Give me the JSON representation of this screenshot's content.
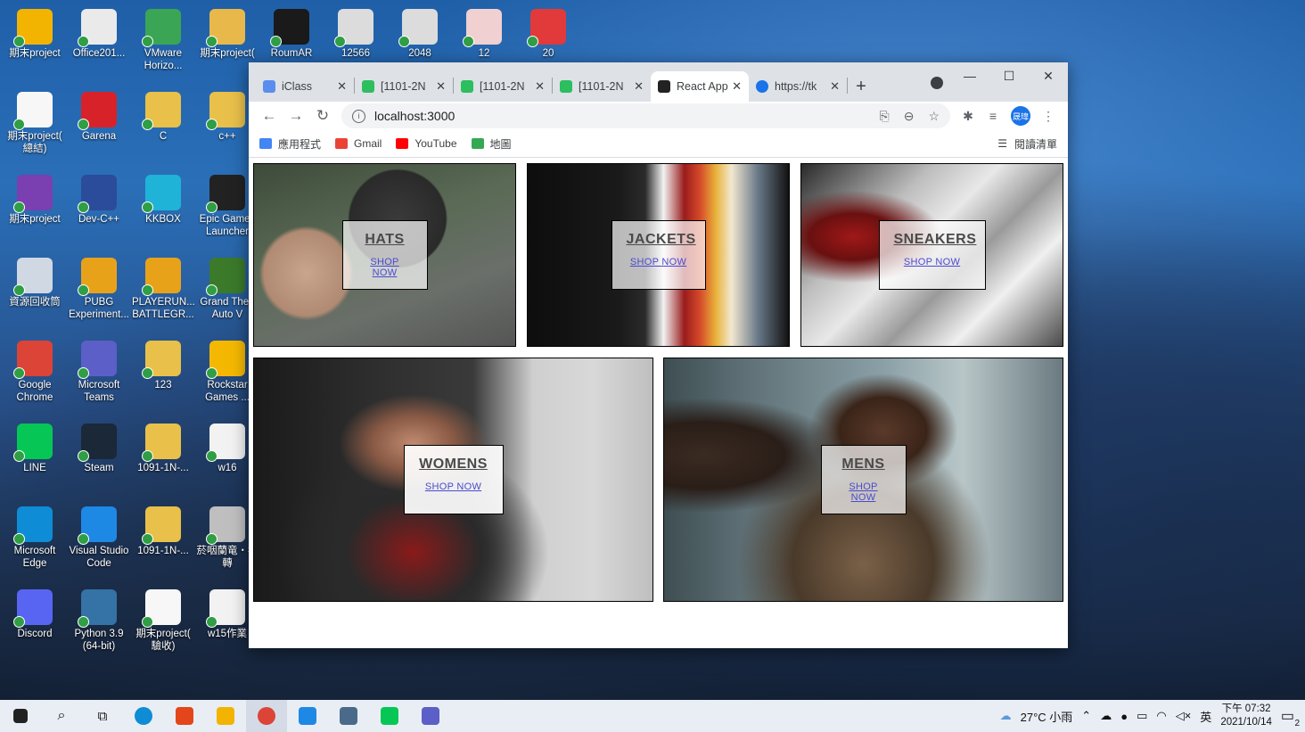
{
  "desktop": {
    "icons": [
      {
        "label": "期末project",
        "color": "#f2b400"
      },
      {
        "label": "Office201...",
        "color": "#eaeaea"
      },
      {
        "label": "VMware Horizo...",
        "color": "#3aa655"
      },
      {
        "label": "期末project(",
        "color": "#e8b94a"
      },
      {
        "label": "RoumAR",
        "color": "#1a1a1a"
      },
      {
        "label": "12566",
        "color": "#dcdcdc"
      },
      {
        "label": "2048",
        "color": "#dcdcdc"
      },
      {
        "label": "12",
        "color": "#f0d0d0"
      },
      {
        "label": "20",
        "color": "#e23a3a"
      },
      {
        "label": "期末project( 總結)",
        "color": "#f7f7f7"
      },
      {
        "label": "Garena",
        "color": "#d8222a"
      },
      {
        "label": "C",
        "color": "#e8c04a"
      },
      {
        "label": "c++",
        "color": "#e8c04a"
      },
      {
        "label": "期末project",
        "color": "#7a3fb0"
      },
      {
        "label": "Dev-C++",
        "color": "#2b4c9a"
      },
      {
        "label": "KKBOX",
        "color": "#1fb3d8"
      },
      {
        "label": "Epic Games Launcher",
        "color": "#222222"
      },
      {
        "label": "資源回收筒",
        "color": "#cfd8e3"
      },
      {
        "label": "PUBG Experiment...",
        "color": "#e8a21a"
      },
      {
        "label": "PLAYERUN... BATTLEGR...",
        "color": "#e8a21a"
      },
      {
        "label": "Grand Theft Auto V",
        "color": "#3b7a2a"
      },
      {
        "label": "Google Chrome",
        "color": "#db4437"
      },
      {
        "label": "Microsoft Teams",
        "color": "#5b5fc7"
      },
      {
        "label": "123",
        "color": "#e8c04a"
      },
      {
        "label": "Rockstar Games ...",
        "color": "#f5b800"
      },
      {
        "label": "LINE",
        "color": "#06c755"
      },
      {
        "label": "Steam",
        "color": "#1b2838"
      },
      {
        "label": "1091-1N-...",
        "color": "#e8c04a"
      },
      {
        "label": "w16",
        "color": "#f2f2f2"
      },
      {
        "label": "Microsoft Edge",
        "color": "#0f8cd6"
      },
      {
        "label": "Visual Studio Code",
        "color": "#1e88e5"
      },
      {
        "label": "1091-1N-...",
        "color": "#e8c04a"
      },
      {
        "label": "菸咽蘭竜・獨轉",
        "color": "#bfbfbf"
      },
      {
        "label": "Discord",
        "color": "#5865f2"
      },
      {
        "label": "Python 3.9 (64-bit)",
        "color": "#3572a5"
      },
      {
        "label": "期末project( 驗收)",
        "color": "#f7f7f7"
      },
      {
        "label": "w15作業",
        "color": "#f2f2f2"
      }
    ]
  },
  "browser": {
    "tabs": [
      {
        "label": "iClass",
        "color": "#5a8dee"
      },
      {
        "label": "[1101-2N",
        "color": "#2dbe60"
      },
      {
        "label": "[1101-2N",
        "color": "#2dbe60"
      },
      {
        "label": "[1101-2N",
        "color": "#2dbe60"
      },
      {
        "label": "React App",
        "color": "#222222"
      },
      {
        "label": "https://tk",
        "color": "#1a73e8"
      }
    ],
    "new_tab": "+",
    "url": "localhost:3000",
    "bookmarks": [
      {
        "label": "應用程式",
        "color": "#4285f4"
      },
      {
        "label": "Gmail",
        "color": "#ea4335"
      },
      {
        "label": "YouTube",
        "color": "#ff0000"
      },
      {
        "label": "地圖",
        "color": "#34a853"
      }
    ],
    "reading_list": "閱讀清單",
    "avatar_text": "晟瑋"
  },
  "categories": [
    {
      "title": "HATS",
      "cta": "SHOP NOW"
    },
    {
      "title": "JACKETS",
      "cta": "SHOP NOW"
    },
    {
      "title": "SNEAKERS",
      "cta": "SHOP NOW"
    },
    {
      "title": "WOMENS",
      "cta": "SHOP NOW"
    },
    {
      "title": "MENS",
      "cta": "SHOP NOW"
    }
  ],
  "taskbar": {
    "weather": "27°C 小雨",
    "ime": "英",
    "time": "下午 07:32",
    "date": "2021/10/14",
    "notifications": "2"
  }
}
